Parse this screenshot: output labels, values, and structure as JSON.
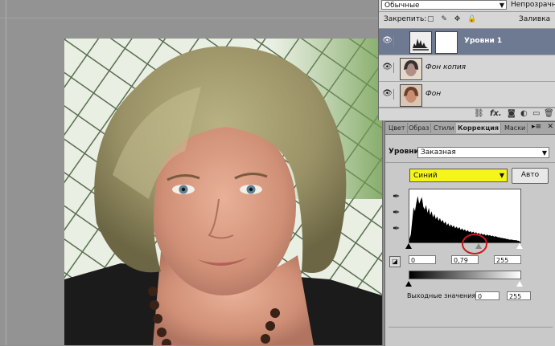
{
  "layers_panel": {
    "blend_mode": "Обычные",
    "opacity_label": "Непрозрачность",
    "lock_label": "Закрепить:",
    "lock_icons": "▢ ✎ ✥ 🔒",
    "fill_label": "Заливка",
    "layers": [
      {
        "name": "Уровни 1",
        "selected": true
      },
      {
        "name": "Фон копия",
        "selected": false
      },
      {
        "name": "Фон",
        "selected": false
      }
    ],
    "bottom_icons": [
      "link-icon",
      "fx-icon",
      "mask-icon",
      "adjustment-icon",
      "folder-icon",
      "new-layer-icon",
      "trash-icon"
    ]
  },
  "adjustments_panel": {
    "tabs": [
      "Цвет",
      "Образ",
      "Стили",
      "Коррекция",
      "Маски"
    ],
    "active_tab": "Коррекция",
    "levels_label": "Уровни",
    "preset_value": "Заказная",
    "channel_value": "Синий",
    "auto_button": "Авто",
    "input_black": "0",
    "input_gamma": "0,79",
    "input_white": "255",
    "output_label": "Выходные значения:",
    "output_black": "0",
    "output_white": "255",
    "gamma_slider_fraction": 0.62,
    "highlight_color": "#d01818",
    "channel_color": "#f5f51a"
  },
  "histogram": {
    "values": [
      6,
      14,
      38,
      62,
      55,
      70,
      82,
      68,
      74,
      80,
      63,
      58,
      66,
      52,
      61,
      48,
      55,
      44,
      50,
      41,
      46,
      38,
      43,
      36,
      40,
      33,
      37,
      30,
      34,
      28,
      32,
      27,
      30,
      25,
      28,
      24,
      27,
      22,
      25,
      21,
      23,
      19,
      22,
      18,
      20,
      17,
      19,
      16,
      18,
      15,
      17,
      14,
      16,
      13,
      15,
      12,
      14,
      12,
      13,
      11,
      12,
      10,
      11,
      10,
      9,
      9,
      8,
      8,
      7,
      7,
      6,
      6,
      5,
      5,
      5,
      4,
      4,
      4,
      3,
      3
    ]
  }
}
